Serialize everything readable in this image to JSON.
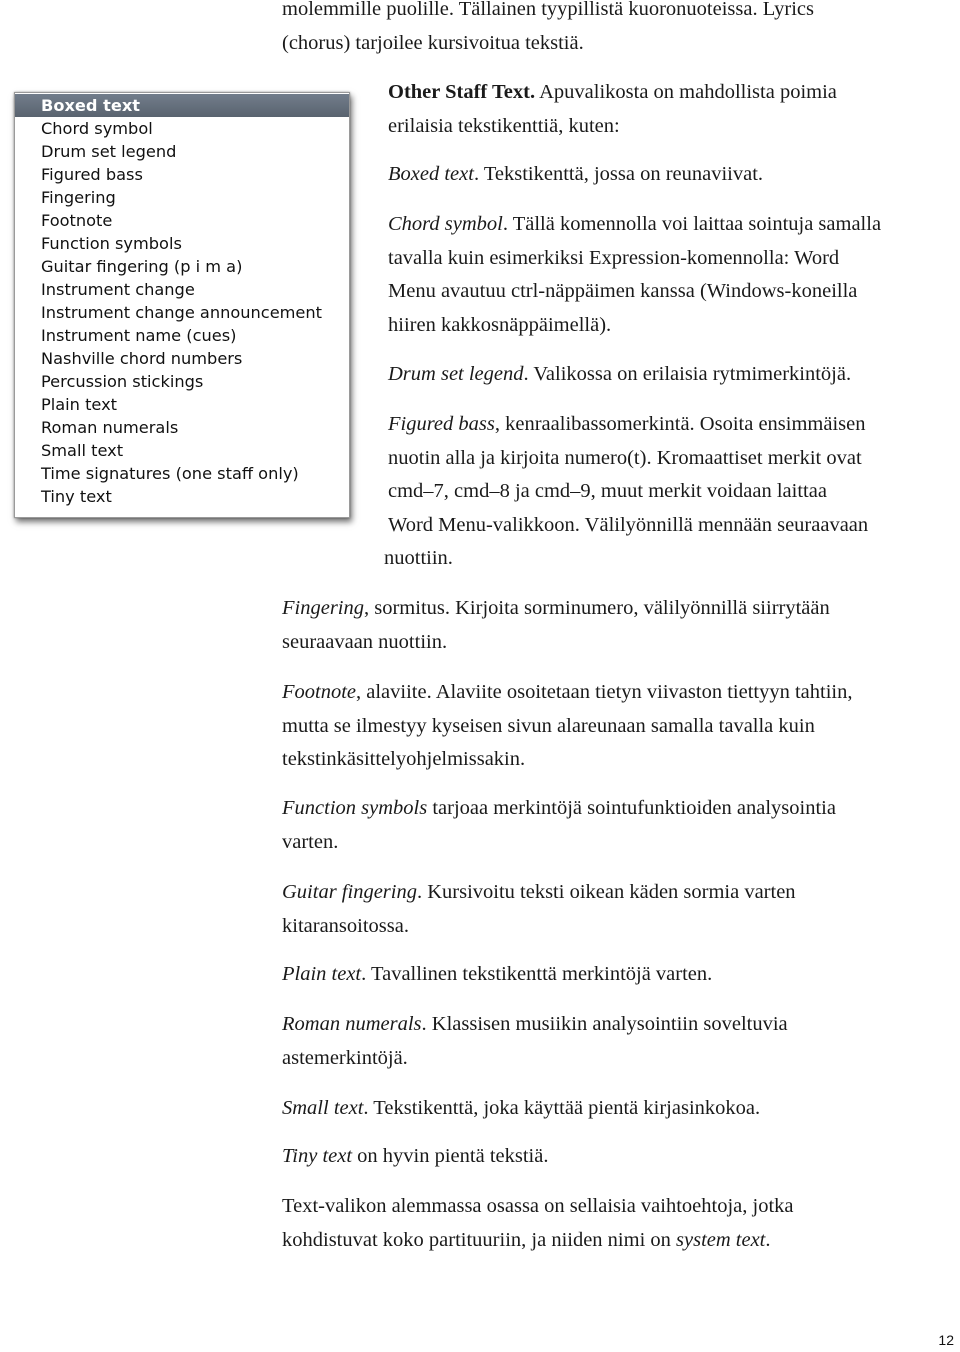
{
  "intro": {
    "line1": "molemmille puolille. Tällainen tyypillistä kuoronuoteissa. Lyrics",
    "line2": "(chorus) tarjoilee kursivoitua tekstiä."
  },
  "menu": {
    "selected_index": 0,
    "items": [
      "Boxed text",
      "Chord symbol",
      "Drum set legend",
      "Figured bass",
      "Fingering",
      "Footnote",
      "Function symbols",
      "Guitar fingering (p i m a)",
      "Instrument change",
      "Instrument change announcement",
      "Instrument name (cues)",
      "Nashville chord numbers",
      "Percussion stickings",
      "Plain text",
      "Roman numerals",
      "Small text",
      "Time signatures (one staff only)",
      "Tiny text"
    ]
  },
  "sections": {
    "other_staff": {
      "term": "Other Staff Text.",
      "line1": " Apuvalikosta on mahdollista poimia",
      "line2": "erilaisia tekstikenttiä, kuten:"
    },
    "boxed": {
      "term": "Boxed text",
      "text": ". Tekstikenttä, jossa on reunaviivat."
    },
    "chord": {
      "term": "Chord symbol",
      "line1": ". Tällä komennolla voi laittaa sointuja samalla",
      "line2": "tavalla kuin esimerkiksi Expression-komennolla: Word",
      "line3": "Menu avautuu ctrl-näppäimen kanssa (Windows-koneilla",
      "line4": "hiiren kakkosnäppäimellä)."
    },
    "drum": {
      "term": "Drum set legend",
      "text": ". Valikossa on erilaisia rytmimerkintöjä."
    },
    "figured": {
      "term": "Figured bass",
      "line1": ", kenraalibassomerkintä. Osoita ensimmäisen",
      "line2": "nuotin alla ja kirjoita numero(t). Kromaattiset merkit ovat",
      "line3": "cmd–7, cmd–8 ja cmd–9, muut merkit voidaan laittaa",
      "line4": "Word Menu-valikkoon. Välilyönnillä mennään seuraavaan",
      "line5": "nuottiin."
    },
    "fingering": {
      "term": "Fingering",
      "line1": ", sormitus. Kirjoita sorminumero, välilyönnillä siirrytään",
      "line2": "seuraavaan nuottiin."
    },
    "footnote": {
      "term": "Footnote",
      "line1": ", alaviite. Alaviite osoitetaan tietyn viivaston tiettyyn tahtiin,",
      "line2": "mutta se ilmestyy kyseisen sivun alareunaan samalla tavalla kuin",
      "line3": "tekstinkäsittelyohjelmissakin."
    },
    "function": {
      "term": "Function symbols",
      "line1": " tarjoaa merkintöjä sointufunktioiden analysointia",
      "line2": "varten."
    },
    "guitar": {
      "term": "Guitar fingering",
      "line1": ". Kursivoitu teksti oikean käden sormia varten",
      "line2": "kitaransoitossa."
    },
    "plain": {
      "term": "Plain text",
      "text": ". Tavallinen tekstikenttä merkintöjä varten."
    },
    "roman": {
      "term": "Roman numerals",
      "line1": ". Klassisen musiikin analysointiin soveltuvia",
      "line2": "astemerkintöjä."
    },
    "small": {
      "term": "Small text",
      "text": ". Tekstikenttä, joka käyttää pientä kirjasinkokoa."
    },
    "tiny": {
      "term": "Tiny text",
      "text": " on hyvin pientä tekstiä."
    },
    "system": {
      "line1": "Text-valikon alemmassa osassa on sellaisia vaihtoehtoja, jotka",
      "line2_pre": "kohdistuvat koko partituuriin, ja niiden nimi on ",
      "line2_term": "system text",
      "line2_post": "."
    }
  },
  "page_number": "12"
}
